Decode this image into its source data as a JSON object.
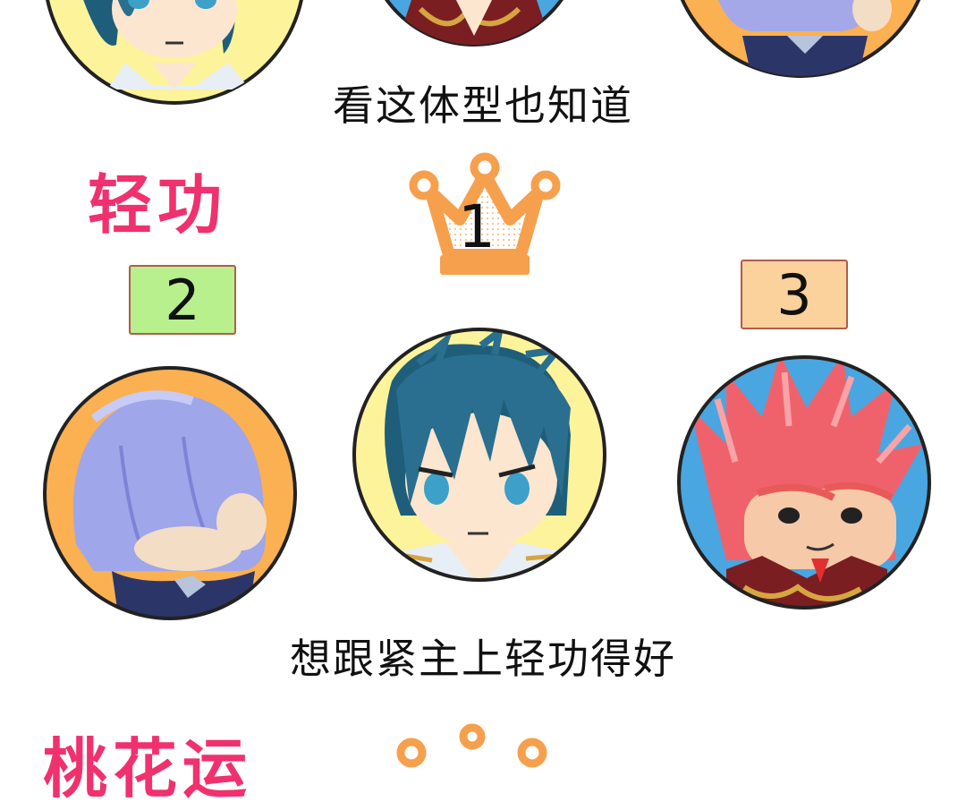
{
  "captions": {
    "top": "看这体型也知道",
    "bottom": "想跟紧主上轻功得好"
  },
  "categories": {
    "qinggong": "轻功",
    "next_partial": "桃花运"
  },
  "ranks": {
    "first": "1",
    "second": "2",
    "third": "3"
  },
  "colors": {
    "category_pink": "#f0316e",
    "crown_orange": "#f6a04d",
    "bg_yellow": "#fdf39a",
    "bg_orange": "#fbb052",
    "bg_blue": "#4aa6e0",
    "badge_green": "#b8f08e",
    "badge_orange": "#fbd19c"
  },
  "avatars": [
    {
      "name": "blue-haired-swordsman",
      "bg": "yellow"
    },
    {
      "name": "red-haired-warrior",
      "bg": "blue"
    },
    {
      "name": "lavender-haired-youth",
      "bg": "orange"
    }
  ]
}
